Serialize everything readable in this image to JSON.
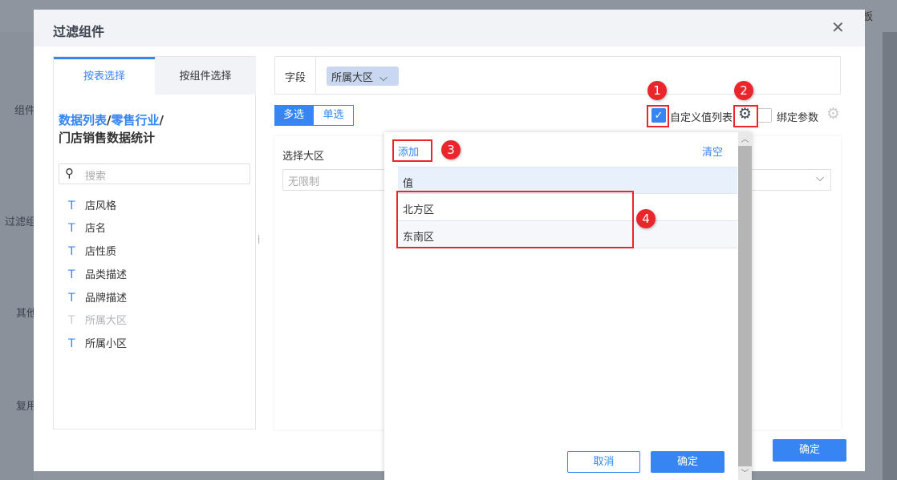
{
  "background": {
    "side_labels": [
      "组件",
      "过滤组",
      "其他",
      "复用"
    ],
    "top_right_text": "板"
  },
  "dialog": {
    "title": "过滤组件",
    "confirm_label": "确定"
  },
  "left_panel": {
    "tabs": [
      {
        "label": "按表选择",
        "active": true
      },
      {
        "label": "按组件选择",
        "active": false
      }
    ],
    "path": {
      "part1": "数据列表",
      "sep1": "/",
      "part2": "零售行业",
      "sep2": "/",
      "table": "门店销售数据统计"
    },
    "search_placeholder": "搜索",
    "fields": [
      {
        "label": "店风格",
        "disabled": false
      },
      {
        "label": "店名",
        "disabled": false
      },
      {
        "label": "店性质",
        "disabled": false
      },
      {
        "label": "品类描述",
        "disabled": false
      },
      {
        "label": "品牌描述",
        "disabled": false
      },
      {
        "label": "所属大区",
        "disabled": true
      },
      {
        "label": "所属小区",
        "disabled": false
      }
    ]
  },
  "right_panel": {
    "field_label": "字段",
    "field_tag": "所属大区",
    "mode_multi": "多选",
    "mode_single": "单选",
    "custom_list_label": "自定义值列表",
    "custom_list_checked": true,
    "bind_param_label": "绑定参数",
    "bind_param_checked": false,
    "select_label": "选择大区",
    "select_placeholder": "无限制"
  },
  "popup": {
    "add_label": "添加",
    "clear_label": "清空",
    "column_header": "值",
    "values": [
      "北方区",
      "东南区"
    ],
    "cancel_label": "取消",
    "confirm_label": "确定"
  },
  "annotations": [
    "1",
    "2",
    "3",
    "4"
  ],
  "colors": {
    "accent": "#3685f2",
    "annotation": "#e8262b"
  }
}
